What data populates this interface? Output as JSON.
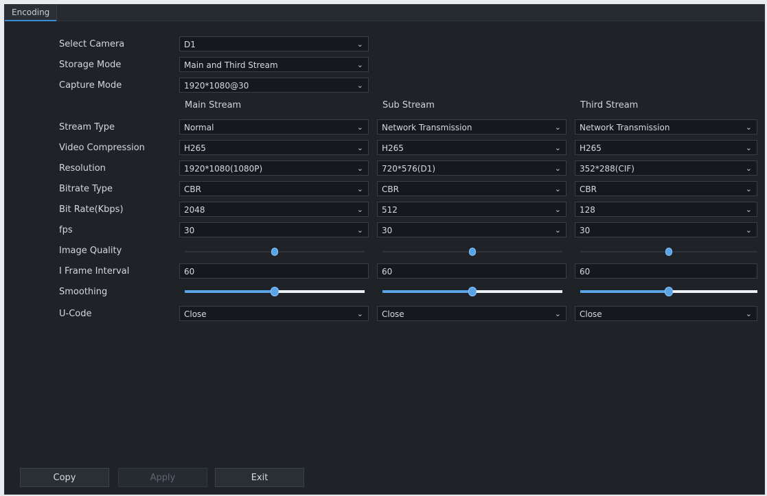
{
  "window": {
    "tab_title": "Encoding"
  },
  "top_settings": [
    {
      "label": "Select Camera",
      "value": "D1"
    },
    {
      "label": "Storage Mode",
      "value": "Main and Third Stream"
    },
    {
      "label": "Capture Mode",
      "value": "1920*1080@30"
    }
  ],
  "columns": [
    "Main Stream",
    "Sub Stream",
    "Third Stream"
  ],
  "rows": [
    {
      "label": "Stream Type",
      "control": "select",
      "values": [
        "Normal",
        "Network Transmission",
        "Network Transmission"
      ]
    },
    {
      "label": "Video Compression",
      "control": "select",
      "values": [
        "H265",
        "H265",
        "H265"
      ]
    },
    {
      "label": "Resolution",
      "control": "select",
      "values": [
        "1920*1080(1080P)",
        "720*576(D1)",
        "352*288(CIF)"
      ]
    },
    {
      "label": "Bitrate Type",
      "control": "select",
      "values": [
        "CBR",
        "CBR",
        "CBR"
      ]
    },
    {
      "label": "Bit Rate(Kbps)",
      "control": "select",
      "values": [
        "2048",
        "512",
        "128"
      ]
    },
    {
      "label": "fps",
      "control": "select",
      "values": [
        "30",
        "30",
        "30"
      ]
    },
    {
      "label": "Image Quality",
      "control": "slider"
    },
    {
      "label": "I Frame Interval",
      "control": "input",
      "values": [
        "60",
        "60",
        "60"
      ]
    },
    {
      "label": "Smoothing",
      "control": "slider"
    },
    {
      "label": "U-Code",
      "control": "select",
      "values": [
        "Close",
        "Close",
        "Close"
      ]
    }
  ],
  "sliders": {
    "image_quality": [
      0.5,
      0.5,
      0.5
    ],
    "smoothing": [
      0.5,
      0.5,
      0.5
    ]
  },
  "buttons": {
    "copy": "Copy",
    "apply": "Apply",
    "exit": "Exit"
  },
  "icons": {
    "dropdown": "chevron-down-icon"
  },
  "colors": {
    "accent": "#5aa4e6",
    "background": "#1f2328"
  }
}
